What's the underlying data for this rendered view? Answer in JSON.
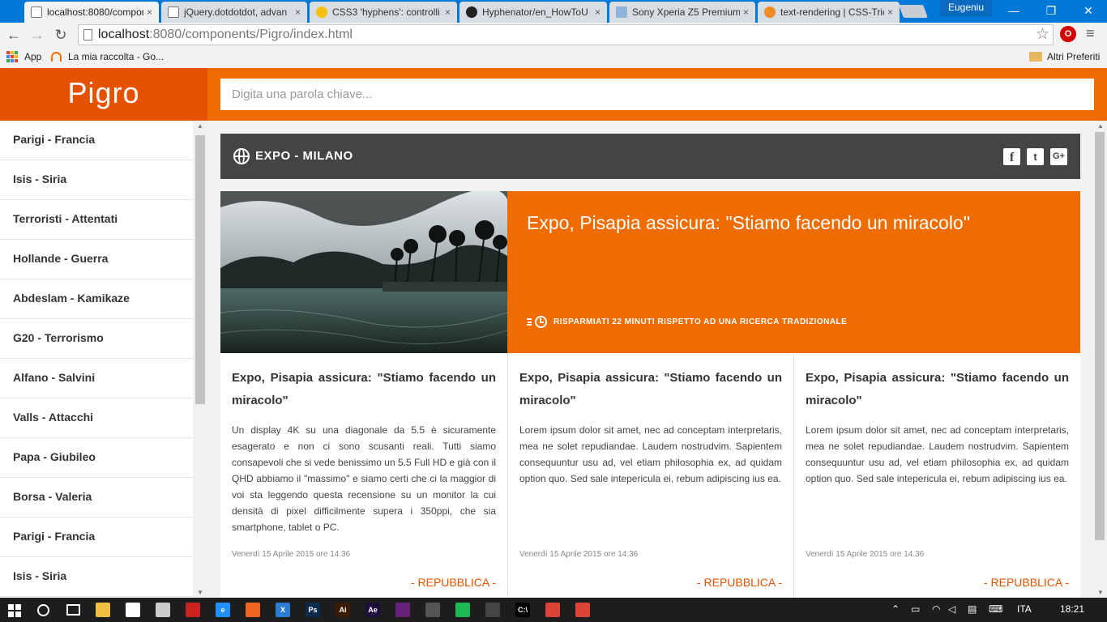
{
  "browser": {
    "tabs": [
      {
        "title": "localhost:8080/compone",
        "active": true,
        "favicon_color": "#ffffff"
      },
      {
        "title": "jQuery.dotdotdot, advan",
        "active": false,
        "favicon_color": "#ffffff"
      },
      {
        "title": "CSS3 'hyphens': controlli",
        "active": false,
        "favicon_color": "#f4c20d"
      },
      {
        "title": "Hyphenator/en_HowToU",
        "active": false,
        "favicon_color": "#222222"
      },
      {
        "title": "Sony Xperia Z5 Premium",
        "active": false,
        "favicon_color": "#8fb3d9"
      },
      {
        "title": "text-rendering | CSS-Tric",
        "active": false,
        "favicon_color": "#f08a24"
      }
    ],
    "tab_close": "×",
    "profile_name": "Eugeniu",
    "window_controls": {
      "minimize": "—",
      "maximize": "❐",
      "close": "✕"
    },
    "nav": {
      "back": "←",
      "forward": "→",
      "reload": "↻"
    },
    "url_host": "localhost",
    "url_rest": ":8080/components/Pigro/index.html",
    "bookmark_star": "☆",
    "extension_label": "O",
    "menu_glyph": "≡",
    "bookmarks": [
      {
        "label": "App",
        "icon": "apps-grid-icon"
      },
      {
        "label": "La mia raccolta - Go...",
        "icon": "headphones-icon"
      }
    ],
    "other_bookmarks": "Altri Preferiti"
  },
  "app": {
    "logo": "Pigro",
    "search_placeholder": "Digita una parola chiave...",
    "sidebar_items": [
      "Parigi - Francia",
      "Isis - Siria",
      "Terroristi - Attentati",
      "Hollande - Guerra",
      "Abdeslam - Kamikaze",
      "G20 - Terrorismo",
      "Alfano - Salvini",
      "Valls - Attacchi",
      "Papa - Giubileo",
      "Borsa - Valeria",
      "Parigi - Francia",
      "Isis - Siria"
    ],
    "category": {
      "title": "EXPO - MILANO",
      "social": {
        "facebook": "f",
        "twitter": "t",
        "googleplus": "G+"
      }
    },
    "feature": {
      "title": "Expo, Pisapia assicura: \"Stiamo facendo un miracolo\"",
      "saving": "RISPARMIATI 22 MINUTI RISPETTO AD UNA RICERCA TRADIZIONALE"
    },
    "cards": [
      {
        "title": "Expo, Pisapia assicura: \"Stiamo facendo un miracolo\"",
        "text": "Un display 4K su una diagonale da 5.5 è sicuramente esagerato e non ci sono scusanti reali. Tutti siamo consapevoli che si vede benissimo un 5.5 Full HD e già con il QHD abbiamo il \"massimo\" e siamo certi che ci la maggior di voi sta leggendo questa recensione su un monitor la cui densità di pixel difficilmente supera i 350ppi, che sia smartphone, tablet o PC.",
        "date": "Venerdì 15 Aprile 2015 ore 14.36",
        "source": "- REPUBBLICA -"
      },
      {
        "title": "Expo, Pisapia assicura: \"Stiamo facendo un miracolo\"",
        "text": "Lorem ipsum dolor sit amet, nec ad conceptam interpretaris, mea ne solet repudiandae. Laudem nostrudvim. Sapientem consequuntur usu ad, vel etiam philosophia ex, ad quidam option quo. Sed sale intepericula ei, rebum adipiscing ius ea.",
        "date": "Venerdì 15 Aprile 2015 ore 14.36",
        "source": "- REPUBBLICA -"
      },
      {
        "title": "Expo, Pisapia assicura: \"Stiamo facendo un miracolo\"",
        "text": "Lorem ipsum dolor sit amet, nec ad conceptam interpretaris, mea ne solet repudiandae. Laudem nostrudvim. Sapientem consequuntur usu ad, vel etiam philosophia ex, ad quidam option quo. Sed sale intepericula ei, rebum adipiscing ius ea.",
        "date": "Venerdì 15 Aprile 2015 ore 14.36",
        "source": "- REPUBBLICA -"
      }
    ]
  },
  "taskbar": {
    "apps": [
      {
        "icon": "file-explorer-icon",
        "color": "#f0c040",
        "label": ""
      },
      {
        "icon": "store-icon",
        "color": "#ffffff",
        "label": ""
      },
      {
        "icon": "3d-icon",
        "color": "#cccccc",
        "label": ""
      },
      {
        "icon": "ruby-icon",
        "color": "#cc2222",
        "label": ""
      },
      {
        "icon": "edge-icon",
        "color": "#1e90ff",
        "label": "e"
      },
      {
        "icon": "app-orange-icon",
        "color": "#f26522",
        "label": ""
      },
      {
        "icon": "app-blue-x-icon",
        "color": "#2b7cd3",
        "label": "X"
      },
      {
        "icon": "photoshop-icon",
        "color": "#0b2b4a",
        "label": "Ps"
      },
      {
        "icon": "illustrator-icon",
        "color": "#3a1b00",
        "label": "Ai"
      },
      {
        "icon": "after-effects-icon",
        "color": "#1d0d3c",
        "label": "Ae"
      },
      {
        "icon": "visual-studio-icon",
        "color": "#68217a",
        "label": ""
      },
      {
        "icon": "app-image-icon",
        "color": "#555555",
        "label": ""
      },
      {
        "icon": "spotify-icon",
        "color": "#1db954",
        "label": ""
      },
      {
        "icon": "calculator-icon",
        "color": "#444444",
        "label": ""
      },
      {
        "icon": "terminal-icon",
        "color": "#000000",
        "label": "C:\\"
      },
      {
        "icon": "chrome-icon",
        "color": "#db4437",
        "label": ""
      },
      {
        "icon": "chrome-icon-2",
        "color": "#db4437",
        "label": ""
      }
    ],
    "lang": "ITA",
    "time": "18:21"
  }
}
